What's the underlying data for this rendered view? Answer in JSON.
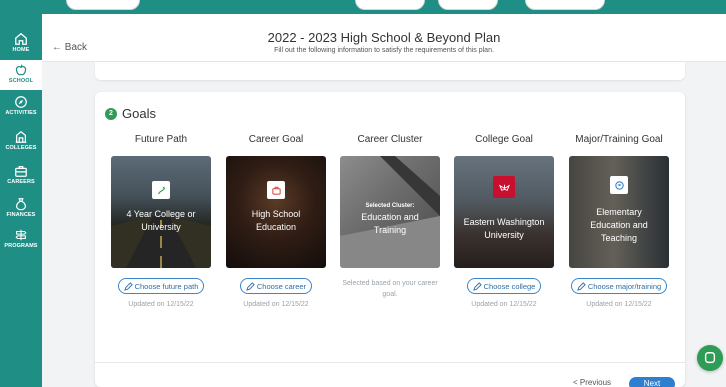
{
  "nav": [
    {
      "label": "HOME",
      "icon": "home-icon"
    },
    {
      "label": "SCHOOL",
      "icon": "apple-icon"
    },
    {
      "label": "ACTIVITIES",
      "icon": "compass-icon"
    },
    {
      "label": "COLLEGES",
      "icon": "building-icon"
    },
    {
      "label": "CAREERS",
      "icon": "briefcase-icon"
    },
    {
      "label": "FINANCES",
      "icon": "money-bag-icon"
    },
    {
      "label": "PROGRAMS",
      "icon": "signpost-icon"
    }
  ],
  "header": {
    "back_label": "← Back",
    "title": "2022 - 2023 High School & Beyond Plan",
    "subtitle": "Fill out the following information to satisfy the requirements of this plan."
  },
  "goals": {
    "step": "2",
    "title": "Goals",
    "columns": [
      {
        "heading": "Future Path",
        "value": "4 Year College or University",
        "button": "Choose future path",
        "updated": "Updated on 12/15/22"
      },
      {
        "heading": "Career Goal",
        "value": "High School Education",
        "button": "Choose career",
        "updated": "Updated on 12/15/22"
      },
      {
        "heading": "Career Cluster",
        "selected_label": "Selected Cluster:",
        "value": "Education and Training",
        "note": "Selected based on your career goal."
      },
      {
        "heading": "College Goal",
        "value": "Eastern Washington University",
        "button": "Choose college",
        "updated": "Updated on 12/15/22"
      },
      {
        "heading": "Major/Training Goal",
        "value": "Elementary Education and Teaching",
        "button": "Choose major/training",
        "updated": "Updated on 12/15/22"
      }
    ]
  },
  "footer": {
    "prev_label": "< Previous",
    "next_label": "Next"
  },
  "colors": {
    "teal": "#1f8f86",
    "accent_blue": "#2f7fd0",
    "green": "#2f9b57"
  }
}
